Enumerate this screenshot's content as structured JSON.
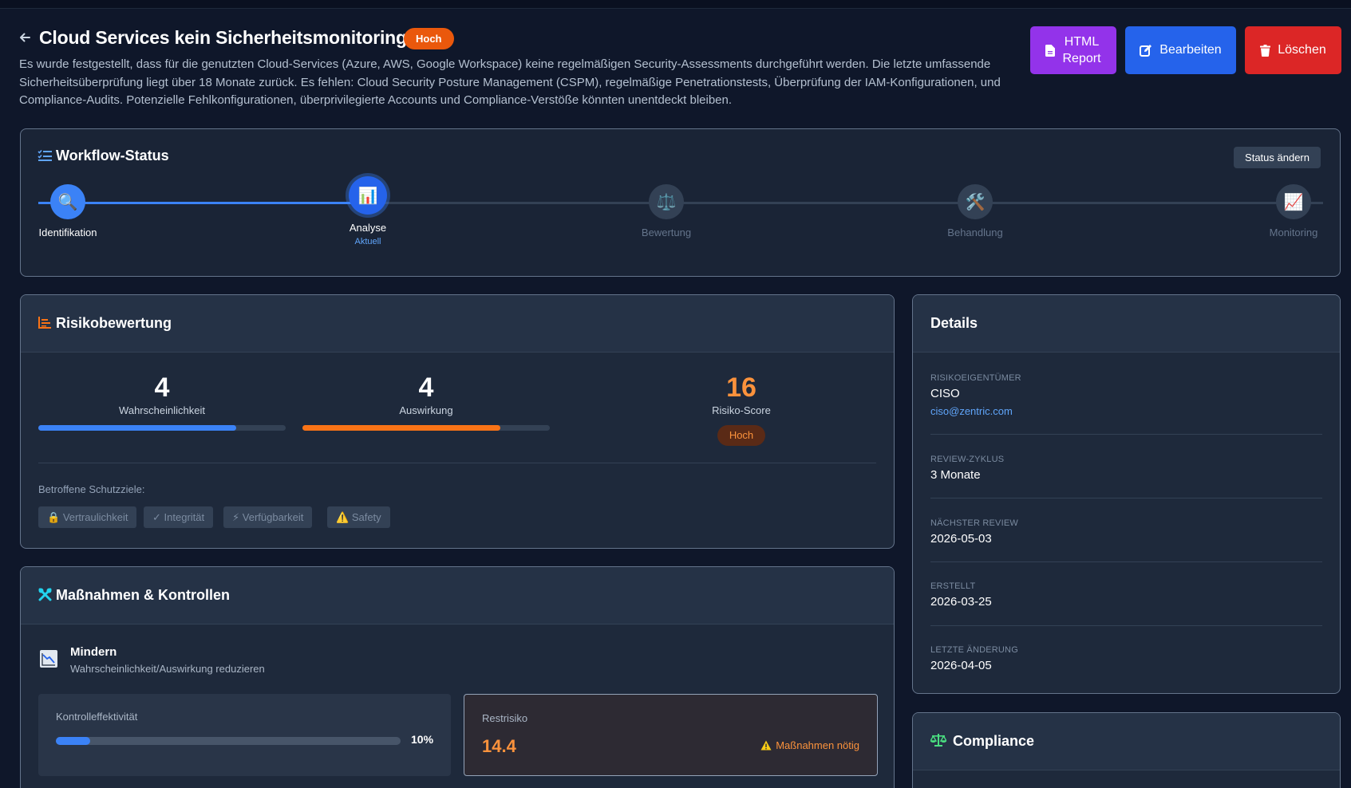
{
  "header": {
    "title": "Cloud Services kein Sicherheitsmonitoring",
    "severity": "Hoch",
    "description": "Es wurde festgestellt, dass für die genutzten Cloud-Services (Azure, AWS, Google Workspace) keine regelmäßigen Security-Assessments durchgeführt werden. Die letzte umfassende Sicherheitsüberprüfung liegt über 18 Monate zurück. Es fehlen: Cloud Security Posture Management (CSPM), regelmäßige Penetrationstests, Überprüfung der IAM-Konfigurationen, und Compliance-Audits. Potenzielle Fehlkonfigurationen, überprivilegierte Accounts und Compliance-Verstöße könnten unentdeckt bleiben.",
    "buttons": {
      "report": "HTML Report",
      "edit": "Bearbeiten",
      "delete": "Löschen"
    }
  },
  "workflow": {
    "title": "Workflow-Status",
    "change_status": "Status ändern",
    "current_label": "Aktuell",
    "steps": [
      {
        "label": "Identifikation",
        "icon": "🔍",
        "state": "done"
      },
      {
        "label": "Analyse",
        "icon": "📊",
        "state": "current"
      },
      {
        "label": "Bewertung",
        "icon": "⚖️",
        "state": "todo"
      },
      {
        "label": "Behandlung",
        "icon": "🛠️",
        "state": "todo"
      },
      {
        "label": "Monitoring",
        "icon": "📈",
        "state": "todo"
      }
    ]
  },
  "risk": {
    "title": "Risikobewertung",
    "likelihood": {
      "value": "4",
      "label": "Wahrscheinlichkeit",
      "fill": 0.8,
      "color": "#3b82f6"
    },
    "impact": {
      "value": "4",
      "label": "Auswirkung",
      "fill": 0.8,
      "color": "#f97316"
    },
    "score": {
      "value": "16",
      "label": "Risiko-Score",
      "level": "Hoch",
      "color": "#fb923c"
    },
    "protection_goals_label": "Betroffene Schutzziele:",
    "protection_goals": [
      {
        "icon": "🔒",
        "label": "Vertraulichkeit"
      },
      {
        "icon": "✓",
        "label": "Integrität"
      },
      {
        "icon": "⚡",
        "label": "Verfügbarkeit"
      },
      {
        "icon": "⚠️",
        "label": "Safety"
      }
    ]
  },
  "measures": {
    "title": "Maßnahmen & Kontrollen",
    "strategy": "Mindern",
    "strategy_desc": "Wahrscheinlichkeit/Auswirkung reduzieren",
    "control_label": "Kontrolleffektivität",
    "control_value": "10%",
    "control_fill": 0.1,
    "residual_label": "Restrisiko",
    "residual_value": "14.4",
    "residual_warning": "Maßnahmen nötig"
  },
  "details": {
    "title": "Details",
    "owner_label": "Risikoeigentümer",
    "owner": "CISO",
    "owner_email": "ciso@zentric.com",
    "review_cycle_label": "Review-Zyklus",
    "review_cycle": "3 Monate",
    "next_review_label": "Nächster Review",
    "next_review": "2026-05-03",
    "created_label": "Erstellt",
    "created": "2026-03-25",
    "modified_label": "Letzte Änderung",
    "modified": "2026-04-05"
  },
  "compliance": {
    "title": "Compliance"
  },
  "colors": {
    "background": "#0f172a",
    "card": "#1e293b",
    "accent_blue": "#3b82f6",
    "accent_orange": "#f97316",
    "report_purple": "#9333ea",
    "delete_red": "#dc2626"
  }
}
